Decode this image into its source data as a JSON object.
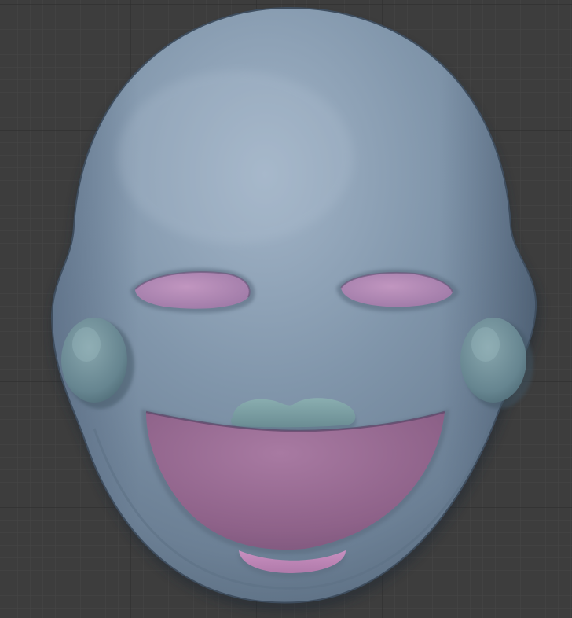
{
  "viewport": {
    "background_color": "#3d3d3d",
    "grid_minor_color": "#474747",
    "grid_major_color": "#2e2e2e"
  },
  "mask": {
    "face_color": "#7e93a8",
    "face_highlight_color": "#9fb2c6",
    "face_shadow_color": "#4f6276",
    "eye_color": "#b58bb6",
    "mouth_color": "#9e6d95",
    "chin_accent_color": "#c688bd",
    "cheek_color": "#6f9098",
    "nose_color": "#7fa2a5"
  }
}
